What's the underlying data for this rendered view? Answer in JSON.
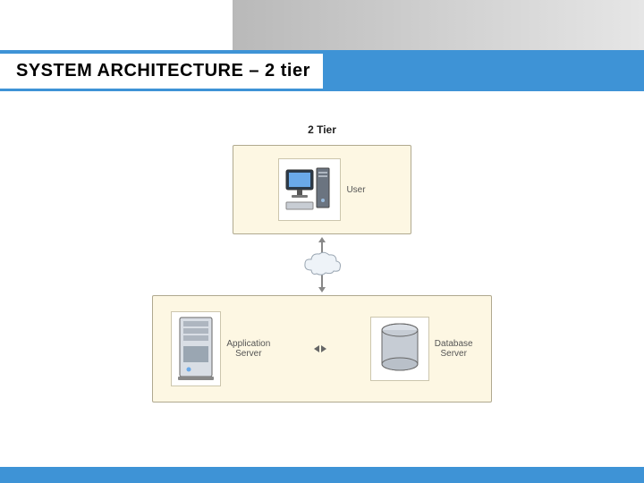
{
  "slide": {
    "title": "SYSTEM ARCHITECTURE – 2 tier"
  },
  "diagram": {
    "heading": "2 Tier",
    "top_box": {
      "label": "User"
    },
    "bottom_box": {
      "left_label_line1": "Application",
      "left_label_line2": "Server",
      "right_label_line1": "Database",
      "right_label_line2": "Server"
    }
  }
}
